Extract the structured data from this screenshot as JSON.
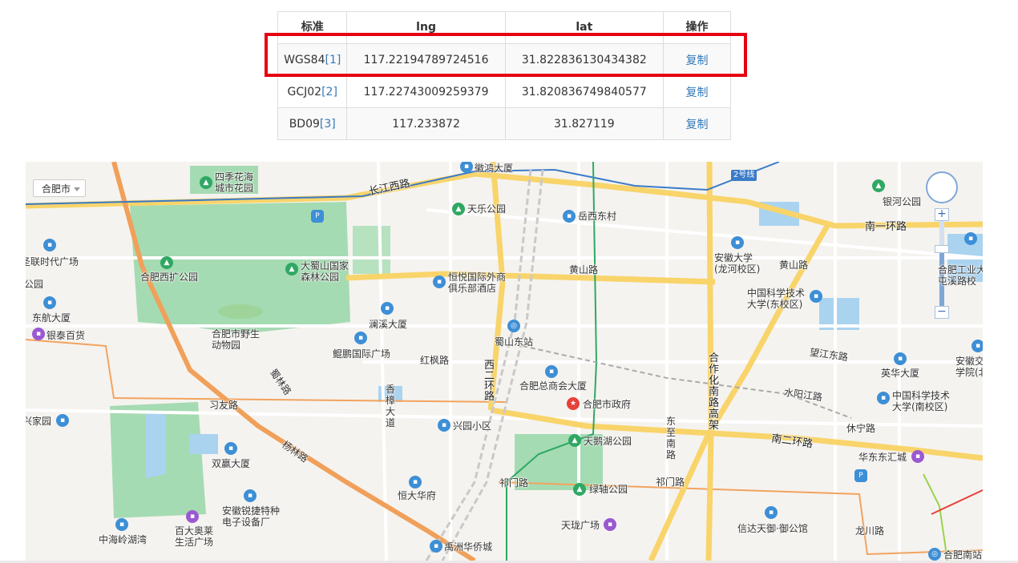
{
  "table": {
    "headers": [
      "标准",
      "lng",
      "lat",
      "操作"
    ],
    "rows": [
      {
        "standard": "WGS84",
        "ref": "[1]",
        "lng": "117.22194789724516",
        "lat": "31.822836130434382",
        "action": "复制"
      },
      {
        "standard": "GCJ02",
        "ref": "[2]",
        "lng": "117.22743009259379",
        "lat": "31.820836749840577",
        "action": "复制"
      },
      {
        "standard": "BD09",
        "ref": "[3]",
        "lng": "117.233872",
        "lat": "31.827119",
        "action": "复制"
      }
    ]
  },
  "highlight_color": "#e60012",
  "map": {
    "city_select": "合肥市",
    "labels": {
      "sijihuahai": "四季花海\n城市花园",
      "huihong": "徽鸿大厦",
      "changjiang": "长江西路",
      "tianle": "天乐公园",
      "yuexi": "岳西东村",
      "hefeipark": "合肥西扩公园",
      "dashushan": "大蜀山国家\n森林公园",
      "hengyue": "恒悦国际外商\n俱乐部酒店",
      "huangshan1": "黄山路",
      "anhuiuniv": "安徽大学\n(龙河校区)",
      "huangshan2": "黄山路",
      "ustc": "中国科学技术\n大学(东校区)",
      "zoo": "合肥市野生\n动物园",
      "lanxi": "澜溪大厦",
      "shushandong": "蜀山东站",
      "kunpeng": "鲲鹏国际广场",
      "hongfeng": "红枫路",
      "xierhuan": "西\n二\n环\n路",
      "zongshanghui": "合肥总商会大厦",
      "govt": "合肥市政府",
      "hezuohua": "合\n作\n化\n南\n路\n高\n架",
      "wangjiang": "望江东路",
      "yingzuo": "英华大厦",
      "anhuitraffic": "安徽交通\n学院(北",
      "jiangdong": "东航大厦",
      "yintai": "银泰百货",
      "lianshidai": "圣联时代广场",
      "gongyuan": "公园",
      "jiaolin": "蜀林路",
      "xiangzhang": "香\n樟\n大\n道",
      "yihuan": "南一环路",
      "yinhepark": "银河公园",
      "hefeiindustry": "合肥工业大\n屯溪路校",
      "jiyou": "习友路",
      "xingyuan": "兴园小区",
      "tianepark": "天鹅湖公园",
      "donzhi": "东\n至\n南\n路",
      "shuiyang": "水阳江路",
      "ustcsouth": "中国科学技术\n大学(南校区)",
      "xiuning": "休宁路",
      "nanerhuan": "南二环路",
      "huadong": "华东东汇城",
      "xingjiayuan": "兴家园",
      "shuanghu": "双赢大厦",
      "yanglinlu": "杨林路",
      "hengdahua": "恒大华府",
      "qimen1": "祁门路",
      "lvzhou": "绿轴公园",
      "qimen2": "祁门路",
      "anhuiruijie": "安徽锐捷特种\n电子设备厂",
      "zhonghai": "中海岭湖湾",
      "baida": "百大奥莱\n生活广场",
      "tianlong": "天珑广场",
      "xinda": "信达天御·御公馆",
      "longchuan": "龙川路",
      "yuzhou": "禹洲华侨城",
      "hefeisouth": "合肥南站",
      "metro2": "2号线"
    }
  }
}
